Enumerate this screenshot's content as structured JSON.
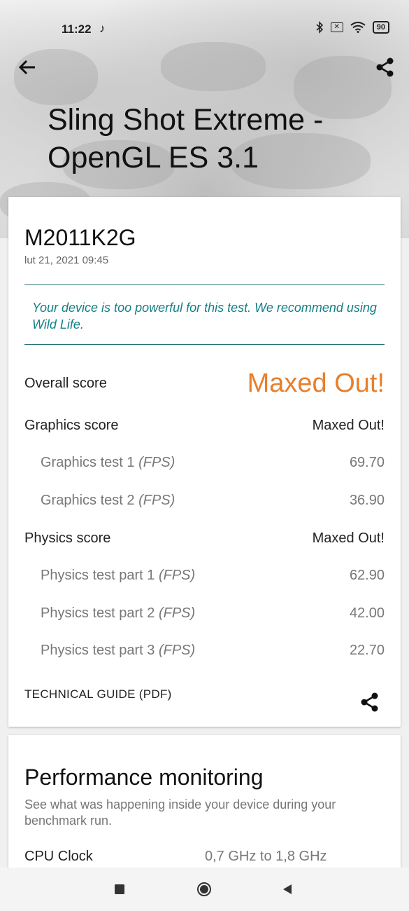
{
  "status_bar": {
    "time": "11:22",
    "battery": "90",
    "icons": [
      "tiktok-icon",
      "bluetooth-icon",
      "sim-off-icon",
      "wifi-icon",
      "battery-icon"
    ]
  },
  "header": {
    "title": "Sling Shot Extreme - OpenGL ES 3.1",
    "back_icon": "arrow-back-icon",
    "share_icon": "share-icon"
  },
  "result": {
    "device": "M2011K2G",
    "date": "lut 21, 2021 09:45",
    "notice": "Your device is too powerful for this test. We recommend using Wild Life.",
    "overall": {
      "label": "Overall score",
      "value": "Maxed Out!"
    },
    "graphics": {
      "label": "Graphics score",
      "value": "Maxed Out!"
    },
    "graphics_tests": [
      {
        "label": "Graphics test 1",
        "unit": "(FPS)",
        "value": "69.70"
      },
      {
        "label": "Graphics test 2",
        "unit": "(FPS)",
        "value": "36.90"
      }
    ],
    "physics": {
      "label": "Physics score",
      "value": "Maxed Out!"
    },
    "physics_tests": [
      {
        "label": "Physics test part 1",
        "unit": "(FPS)",
        "value": "62.90"
      },
      {
        "label": "Physics test part 2",
        "unit": "(FPS)",
        "value": "42.00"
      },
      {
        "label": "Physics test part 3",
        "unit": "(FPS)",
        "value": "22.70"
      }
    ],
    "technical_guide": "TECHNICAL GUIDE (PDF)"
  },
  "performance": {
    "title": "Performance monitoring",
    "subtitle": "See what was happening inside your device during your benchmark run.",
    "cpu_label": "CPU Clock",
    "cpu_value": "0,7 GHz to 1,8 GHz"
  },
  "colors": {
    "accent_orange": "#e87f2a",
    "notice_teal": "#127f86",
    "divider_teal": "#1f6e72"
  },
  "nav_bar": [
    "recents-square-icon",
    "home-circle-icon",
    "back-triangle-icon"
  ]
}
